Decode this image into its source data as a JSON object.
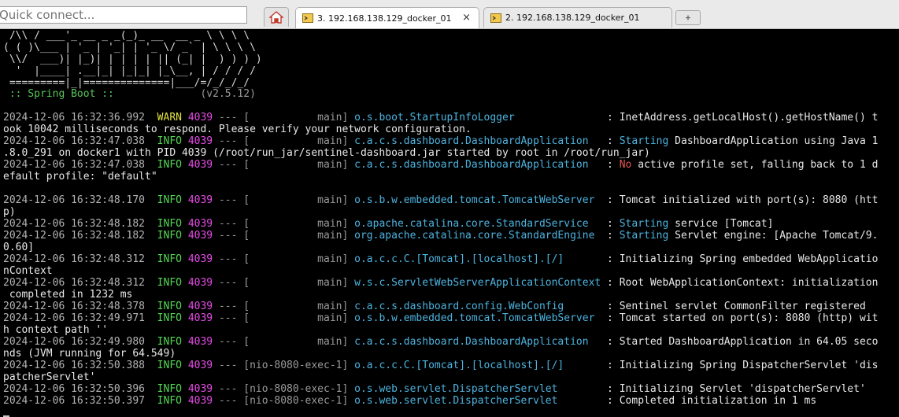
{
  "quick_connect": {
    "placeholder": "Quick connect..."
  },
  "tabs": [
    {
      "label": "3. 192.168.138.129_docker_01",
      "close": "×"
    },
    {
      "label": "2. 192.168.138.129_docker_01"
    }
  ],
  "logo_lines": [
    " /\\\\ / ___'_ __ _ _(_)_ __  __ _ \\ \\ \\ \\",
    "( ( )\\___ | '_ | '_| | '_ \\/ _` | \\ \\ \\ \\",
    " \\\\/  ___)| |_)| | | | | || (_| |  ) ) ) )",
    "  '  |____| .__|_| |_|_| |_\\__, | / / / /",
    " =========|_|==============|___/=/_/_/_/"
  ],
  "spring": {
    "label": " :: Spring Boot :: ",
    "version": "             (v2.5.12)"
  },
  "log": [
    {
      "ts": "2024-12-06 16:32:36.992",
      "lvl": "WARN",
      "pid": "4039",
      "sep": " --- [",
      "thread": "           main] ",
      "logger": "o.s.boot.StartupInfoLogger              ",
      "colon": " : ",
      "msg_hl": "",
      "msg": "InetAddress.getLocalHost().getHostName() t"
    },
    {
      "cont": "ook 10042 milliseconds to respond. Please verify your network configuration."
    },
    {
      "ts": "2024-12-06 16:32:47.038",
      "lvl": "INFO",
      "pid": "4039",
      "sep": " --- [",
      "thread": "           main] ",
      "logger": "c.a.c.s.dashboard.DashboardApplication  ",
      "colon": " : ",
      "msg_hl": "Starting",
      "msg": " DashboardApplication using Java 1"
    },
    {
      "cont": ".8.0_291 on docker1 with PID 4039 (/root/run_jar/sentinel-dashboard.jar started by root in /root/run_jar)"
    },
    {
      "ts": "2024-12-06 16:32:47.038",
      "lvl": "INFO",
      "pid": "4039",
      "sep": " --- [",
      "thread": "           main] ",
      "logger": "c.a.c.s.dashboard.DashboardApplication  ",
      "colon": " : ",
      "msg_red": "No",
      "msg": " active profile set, falling back to 1 d"
    },
    {
      "cont": "efault profile: \"default\""
    },
    {
      "blank": true
    },
    {
      "ts": "2024-12-06 16:32:48.170",
      "lvl": "INFO",
      "pid": "4039",
      "sep": " --- [",
      "thread": "           main] ",
      "logger": "o.s.b.w.embedded.tomcat.TomcatWebServer ",
      "colon": " : ",
      "msg_hl": "",
      "msg": "Tomcat initialized with port(s): 8080 (htt"
    },
    {
      "cont": "p)"
    },
    {
      "ts": "2024-12-06 16:32:48.182",
      "lvl": "INFO",
      "pid": "4039",
      "sep": " --- [",
      "thread": "           main] ",
      "logger": "o.apache.catalina.core.StandardService  ",
      "colon": " : ",
      "msg_hl": "Starting",
      "msg": " service [Tomcat]"
    },
    {
      "ts": "2024-12-06 16:32:48.182",
      "lvl": "INFO",
      "pid": "4039",
      "sep": " --- [",
      "thread": "           main] ",
      "logger": "org.apache.catalina.core.StandardEngine ",
      "colon": " : ",
      "msg_hl": "Starting",
      "msg": " Servlet engine: [Apache Tomcat/9."
    },
    {
      "cont": "0.60]"
    },
    {
      "ts": "2024-12-06 16:32:48.312",
      "lvl": "INFO",
      "pid": "4039",
      "sep": " --- [",
      "thread": "           main] ",
      "logger": "o.a.c.c.C.[Tomcat].[localhost].[/]      ",
      "colon": " : ",
      "msg_hl": "",
      "msg": "Initializing Spring embedded WebApplicatio"
    },
    {
      "cont": "nContext"
    },
    {
      "ts": "2024-12-06 16:32:48.312",
      "lvl": "INFO",
      "pid": "4039",
      "sep": " --- [",
      "thread": "           main] ",
      "logger": "w.s.c.ServletWebServerApplicationContext",
      "colon": " : ",
      "msg_hl": "",
      "msg": "Root WebApplicationContext: initialization"
    },
    {
      "cont": " completed in 1232 ms"
    },
    {
      "ts": "2024-12-06 16:32:48.378",
      "lvl": "INFO",
      "pid": "4039",
      "sep": " --- [",
      "thread": "           main] ",
      "logger": "c.a.c.s.dashboard.config.WebConfig      ",
      "colon": " : ",
      "msg_hl": "",
      "msg": "Sentinel servlet CommonFilter registered"
    },
    {
      "ts": "2024-12-06 16:32:49.971",
      "lvl": "INFO",
      "pid": "4039",
      "sep": " --- [",
      "thread": "           main] ",
      "logger": "o.s.b.w.embedded.tomcat.TomcatWebServer ",
      "colon": " : ",
      "msg_hl": "",
      "msg": "Tomcat started on port(s): 8080 (http) wit"
    },
    {
      "cont": "h context path ''"
    },
    {
      "ts": "2024-12-06 16:32:49.980",
      "lvl": "INFO",
      "pid": "4039",
      "sep": " --- [",
      "thread": "           main] ",
      "logger": "c.a.c.s.dashboard.DashboardApplication  ",
      "colon": " : ",
      "msg_hl": "",
      "msg": "Started DashboardApplication in 64.05 seco"
    },
    {
      "cont": "nds (JVM running for 64.549)"
    },
    {
      "ts": "2024-12-06 16:32:50.388",
      "lvl": "INFO",
      "pid": "4039",
      "sep": " --- [",
      "thread": "nio-8080-exec-1] ",
      "logger": "o.a.c.c.C.[Tomcat].[localhost].[/]      ",
      "colon": " : ",
      "msg_hl": "",
      "msg": "Initializing Spring DispatcherServlet 'dis"
    },
    {
      "cont": "patcherServlet'"
    },
    {
      "ts": "2024-12-06 16:32:50.396",
      "lvl": "INFO",
      "pid": "4039",
      "sep": " --- [",
      "thread": "nio-8080-exec-1] ",
      "logger": "o.s.web.servlet.DispatcherServlet       ",
      "colon": " : ",
      "msg_hl": "",
      "msg": "Initializing Servlet 'dispatcherServlet'"
    },
    {
      "ts": "2024-12-06 16:32:50.397",
      "lvl": "INFO",
      "pid": "4039",
      "sep": " --- [",
      "thread": "nio-8080-exec-1] ",
      "logger": "o.s.web.servlet.DispatcherServlet       ",
      "colon": " : ",
      "msg_hl": "",
      "msg": "Completed initialization in 1 ms"
    }
  ],
  "colors": {
    "info": "#55d655",
    "warn": "#e2e240",
    "pid": "#e64ae6",
    "logger": "#4db3df",
    "error_word": "#e85454"
  },
  "icons": {
    "home": "home-icon",
    "tab": "terminal-tab-icon",
    "close": "close-icon",
    "new_tab": "new-tab-icon"
  }
}
